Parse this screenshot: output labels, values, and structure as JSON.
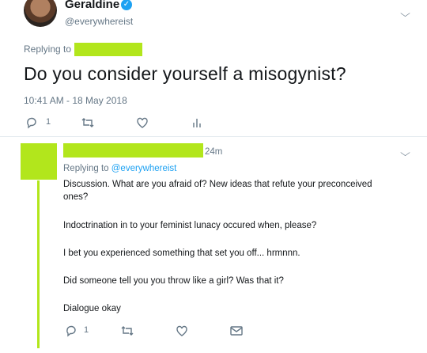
{
  "author": {
    "name": "Geraldine",
    "handle": "@everywhereist"
  },
  "tweet": {
    "replying_prefix": "Replying to",
    "text": "Do you consider yourself a misogynist?",
    "timestamp": "10:41 AM - 18 May 2018",
    "reply_count": "1"
  },
  "reply": {
    "time_ago": "24m",
    "replying_prefix": "Replying to",
    "replying_handle": "@everywhereist",
    "paragraphs": [
      "Discussion. What are you afraid of? New ideas that refute your preconceived ones?",
      "Indoctrination in to your feminist lunacy occured when, please?",
      "I bet you experienced something that set you off... hrmnnn.",
      "Did someone tell you you throw like a girl? Was that it?",
      "Dialogue okay"
    ],
    "reply_count": "1"
  },
  "colors": {
    "accent": "#1da1f2",
    "redaction": "#b2e61c",
    "muted": "#657786"
  }
}
